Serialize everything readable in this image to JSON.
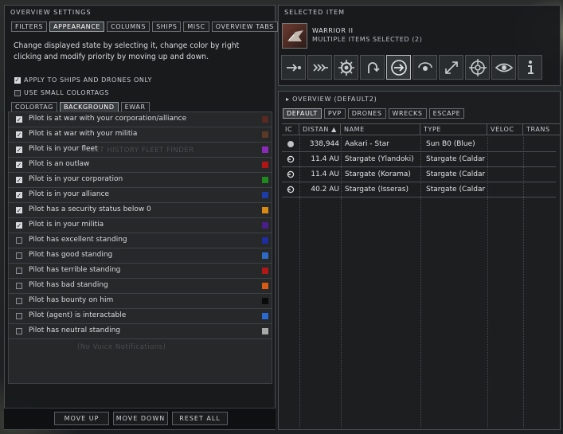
{
  "overview_settings": {
    "title": "OVERVIEW SETTINGS",
    "tabs": [
      {
        "label": "FILTERS",
        "active": false
      },
      {
        "label": "APPEARANCE",
        "active": true
      },
      {
        "label": "COLUMNS",
        "active": false
      },
      {
        "label": "SHIPS",
        "active": false
      },
      {
        "label": "MISC",
        "active": false
      },
      {
        "label": "OVERVIEW TABS",
        "active": false
      }
    ],
    "description": "Change displayed state by selecting it, change color by right clicking and modify priority by moving up and down.",
    "options": [
      {
        "label": "APPLY TO SHIPS AND DRONES ONLY",
        "checked": true
      },
      {
        "label": "USE SMALL COLORTAGS",
        "checked": false
      }
    ],
    "subtabs": [
      {
        "label": "COLORTAG",
        "active": false
      },
      {
        "label": "BACKGROUND",
        "active": true
      },
      {
        "label": "EWAR",
        "active": false
      }
    ],
    "states": [
      {
        "label": "Pilot is at war with your corporation/alliance",
        "checked": true,
        "color": "#5a2a22"
      },
      {
        "label": "Pilot is at war with your militia",
        "checked": true,
        "color": "#5a3a26"
      },
      {
        "label": "Pilot is in your fleet",
        "checked": true,
        "color": "#8a2ab8"
      },
      {
        "label": "Pilot is an outlaw",
        "checked": true,
        "color": "#b01414"
      },
      {
        "label": "Pilot is in your corporation",
        "checked": true,
        "color": "#1e8a1e"
      },
      {
        "label": "Pilot is in your alliance",
        "checked": true,
        "color": "#1e3ca8"
      },
      {
        "label": "Pilot has a security status below 0",
        "checked": true,
        "color": "#d88a14"
      },
      {
        "label": "Pilot is in your militia",
        "checked": true,
        "color": "#4a1e8a"
      },
      {
        "label": "Pilot has excellent standing",
        "checked": false,
        "color": "#1e2ea0"
      },
      {
        "label": "Pilot has good standing",
        "checked": false,
        "color": "#2e6ac8"
      },
      {
        "label": "Pilot has terrible standing",
        "checked": false,
        "color": "#b01818"
      },
      {
        "label": "Pilot has bad standing",
        "checked": false,
        "color": "#d85a14"
      },
      {
        "label": "Pilot has bounty on him",
        "checked": false,
        "color": "#0a0a0a"
      },
      {
        "label": "Pilot (agent) is interactable",
        "checked": false,
        "color": "#2a6ad0"
      },
      {
        "label": "Pilot has neutral standing",
        "checked": false,
        "color": "#a8a8a8"
      }
    ],
    "background_ghost": {
      "fleet_tabs": "FLEET   HISTORY   FLEET FINDER",
      "voice": "(No Voice Notifications)"
    },
    "buttons": {
      "move_up": "MOVE UP",
      "move_down": "MOVE DOWN",
      "reset_all": "RESET ALL"
    }
  },
  "selected_item": {
    "title": "SELECTED ITEM",
    "name": "WARRIOR II",
    "subtitle": "MULTIPLE ITEMS SELECTED (2)",
    "actions": [
      "approach-icon",
      "warp-to-icon",
      "align-to-icon",
      "orbit-icon",
      "jump-icon",
      "keep-at-range-icon",
      "lock-target-icon",
      "target-reticle-icon",
      "look-at-icon",
      "show-info-icon"
    ]
  },
  "overview": {
    "title": "OVERVIEW (DEFAULT2)",
    "tabs": [
      {
        "label": "DEFAULT",
        "active": true
      },
      {
        "label": "PVP",
        "active": false
      },
      {
        "label": "DRONES",
        "active": false
      },
      {
        "label": "WRECKS",
        "active": false
      },
      {
        "label": "ESCAPE",
        "active": false
      }
    ],
    "columns": [
      "IC",
      "DISTAN",
      "NAME",
      "TYPE",
      "VELOC",
      "TRANS"
    ],
    "rows": [
      {
        "icon": "sun-icon",
        "distance": "338,944",
        "name": "Aakari - Star",
        "type": "Sun B0 (Blue)"
      },
      {
        "icon": "stargate-icon",
        "distance": "11.4 AU",
        "name": "Stargate (Ylandoki)",
        "type": "Stargate (Caldar"
      },
      {
        "icon": "stargate-icon",
        "distance": "11.4 AU",
        "name": "Stargate (Korama)",
        "type": "Stargate (Caldar"
      },
      {
        "icon": "stargate-icon",
        "distance": "40.2 AU",
        "name": "Stargate (Isseras)",
        "type": "Stargate (Caldar"
      }
    ]
  }
}
